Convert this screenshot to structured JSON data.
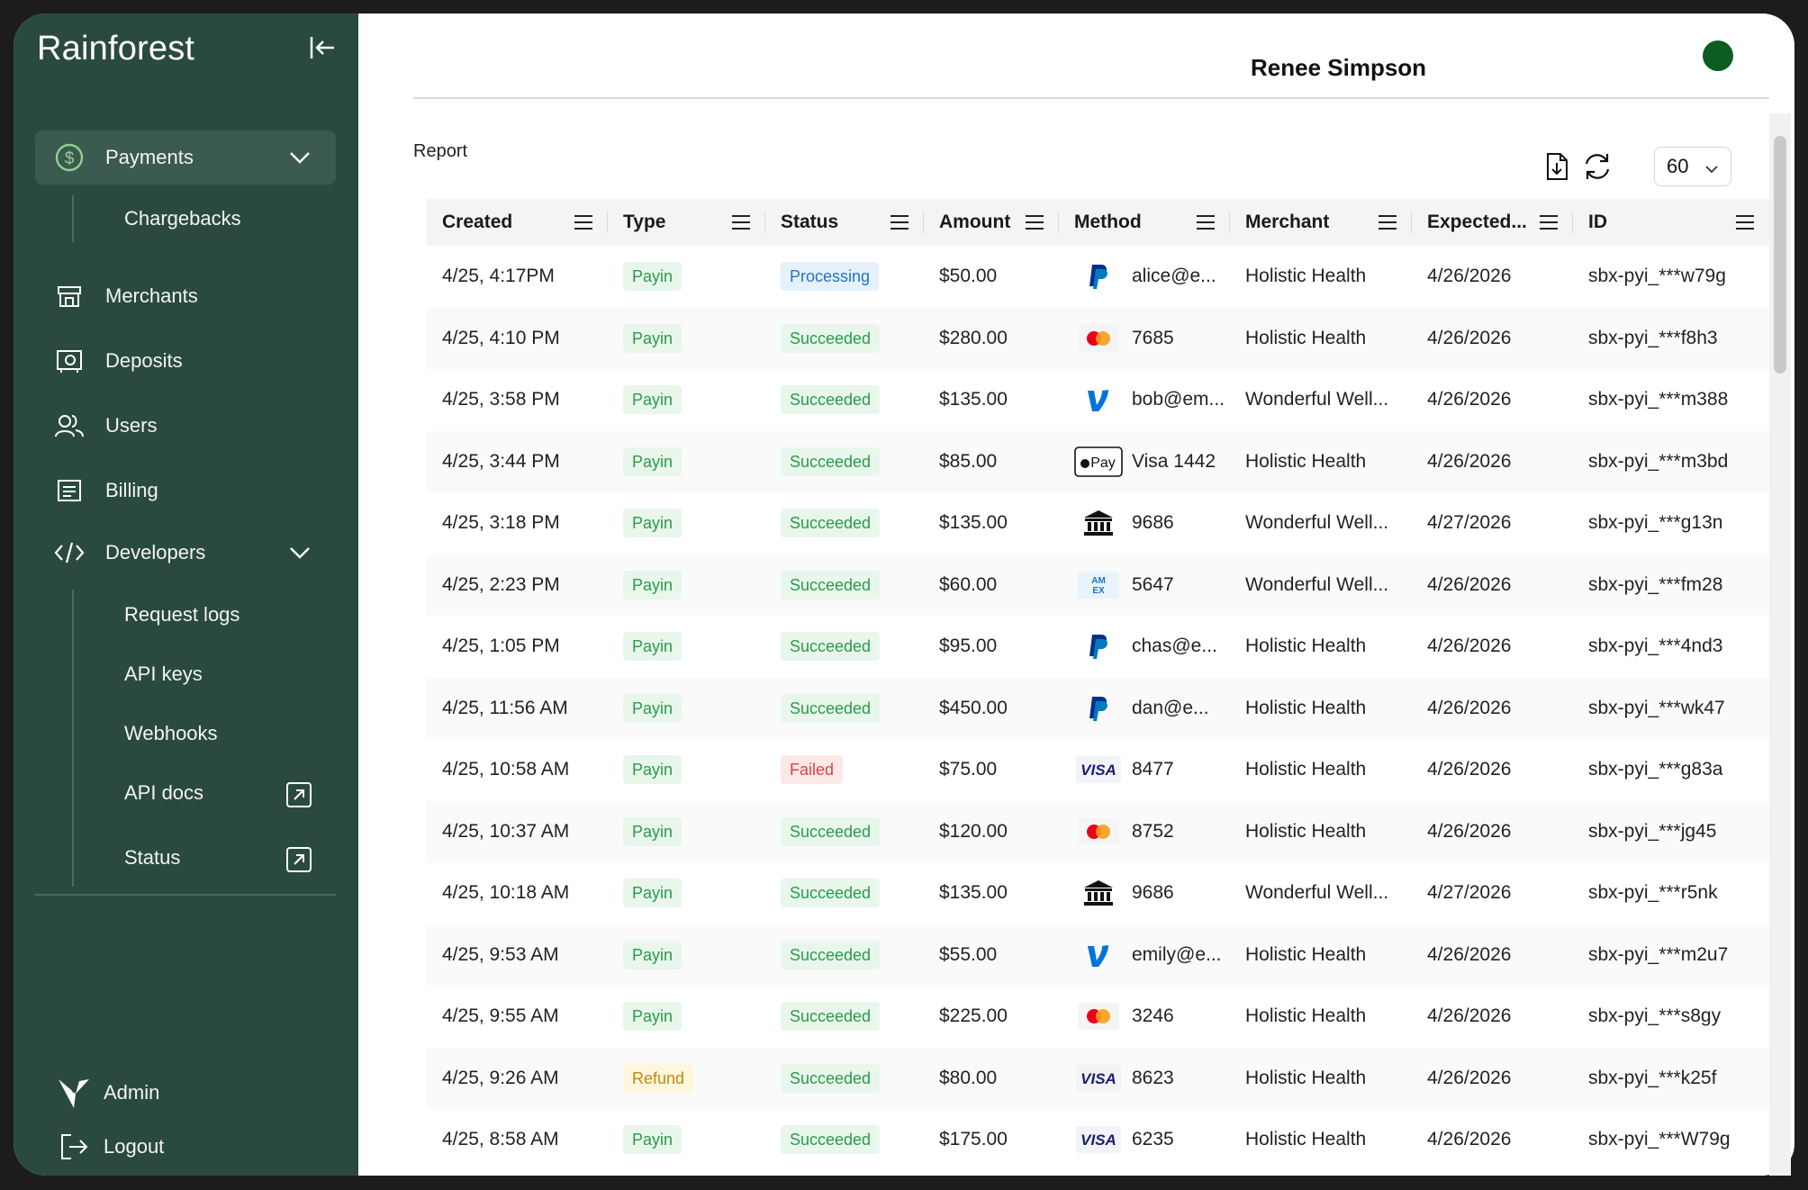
{
  "sidebar": {
    "brand": "Rainforest",
    "nav": {
      "payments": "Payments",
      "chargebacks": "Chargebacks",
      "merchants": "Merchants",
      "deposits": "Deposits",
      "users": "Users",
      "billing": "Billing",
      "developers": "Developers",
      "request_logs": "Request logs",
      "api_keys": "API keys",
      "webhooks": "Webhooks",
      "api_docs": "API docs",
      "status": "Status"
    },
    "footer": {
      "admin": "Admin",
      "logout": "Logout"
    }
  },
  "header": {
    "user_name": "Renee Simpson",
    "avatar_color": "#0d5c24"
  },
  "report": {
    "title": "Report",
    "page_size": "60"
  },
  "columns": [
    "Created",
    "Type",
    "Status",
    "Amount",
    "Method",
    "Merchant",
    "Expected...",
    "ID"
  ],
  "rows": [
    {
      "created": "4/25, 4:17PM",
      "type": "Payin",
      "status": "Processing",
      "amount": "$50.00",
      "method_icon": "paypal-icon",
      "method": "alice@e...",
      "merchant": "Holistic Health",
      "expected": "4/26/2026",
      "id": "sbx-pyi_***w79g"
    },
    {
      "created": "4/25, 4:10 PM",
      "type": "Payin",
      "status": "Succeeded",
      "amount": "$280.00",
      "method_icon": "mastercard-icon",
      "method": "7685",
      "merchant": "Holistic Health",
      "expected": "4/26/2026",
      "id": "sbx-pyi_***f8h3"
    },
    {
      "created": "4/25, 3:58 PM",
      "type": "Payin",
      "status": "Succeeded",
      "amount": "$135.00",
      "method_icon": "venmo-icon",
      "method": "bob@em...",
      "merchant": "Wonderful Well...",
      "expected": "4/26/2026",
      "id": "sbx-pyi_***m388"
    },
    {
      "created": "4/25, 3:44 PM",
      "type": "Payin",
      "status": "Succeeded",
      "amount": "$85.00",
      "method_icon": "apple-pay-icon",
      "method": "Visa 1442",
      "merchant": "Holistic Health",
      "expected": "4/26/2026",
      "id": "sbx-pyi_***m3bd"
    },
    {
      "created": "4/25, 3:18 PM",
      "type": "Payin",
      "status": "Succeeded",
      "amount": "$135.00",
      "method_icon": "bank-icon",
      "method": "9686",
      "merchant": "Wonderful Well...",
      "expected": "4/27/2026",
      "id": "sbx-pyi_***g13n"
    },
    {
      "created": "4/25, 2:23 PM",
      "type": "Payin",
      "status": "Succeeded",
      "amount": "$60.00",
      "method_icon": "amex-icon",
      "method": "5647",
      "merchant": "Wonderful Well...",
      "expected": "4/26/2026",
      "id": "sbx-pyi_***fm28"
    },
    {
      "created": "4/25, 1:05 PM",
      "type": "Payin",
      "status": "Succeeded",
      "amount": "$95.00",
      "method_icon": "paypal-icon",
      "method": "chas@e...",
      "merchant": "Holistic Health",
      "expected": "4/26/2026",
      "id": "sbx-pyi_***4nd3"
    },
    {
      "created": "4/25, 11:56 AM",
      "type": "Payin",
      "status": "Succeeded",
      "amount": "$450.00",
      "method_icon": "paypal-icon",
      "method": "dan@e...",
      "merchant": "Holistic Health",
      "expected": "4/26/2026",
      "id": "sbx-pyi_***wk47"
    },
    {
      "created": "4/25, 10:58 AM",
      "type": "Payin",
      "status": "Failed",
      "amount": "$75.00",
      "method_icon": "visa-icon",
      "method": "8477",
      "merchant": "Holistic Health",
      "expected": "4/26/2026",
      "id": "sbx-pyi_***g83a"
    },
    {
      "created": "4/25, 10:37 AM",
      "type": "Payin",
      "status": "Succeeded",
      "amount": "$120.00",
      "method_icon": "mastercard-icon",
      "method": "8752",
      "merchant": "Holistic Health",
      "expected": "4/26/2026",
      "id": "sbx-pyi_***jg45"
    },
    {
      "created": "4/25, 10:18 AM",
      "type": "Payin",
      "status": "Succeeded",
      "amount": "$135.00",
      "method_icon": "bank-icon",
      "method": "9686",
      "merchant": "Wonderful Well...",
      "expected": "4/27/2026",
      "id": "sbx-pyi_***r5nk"
    },
    {
      "created": "4/25, 9:53 AM",
      "type": "Payin",
      "status": "Succeeded",
      "amount": "$55.00",
      "method_icon": "venmo-icon",
      "method": "emily@e...",
      "merchant": "Holistic Health",
      "expected": "4/26/2026",
      "id": "sbx-pyi_***m2u7"
    },
    {
      "created": "4/25, 9:55 AM",
      "type": "Payin",
      "status": "Succeeded",
      "amount": "$225.00",
      "method_icon": "mastercard-icon",
      "method": "3246",
      "merchant": "Holistic Health",
      "expected": "4/26/2026",
      "id": "sbx-pyi_***s8gy"
    },
    {
      "created": "4/25, 9:26 AM",
      "type": "Refund",
      "status": "Succeeded",
      "amount": "$80.00",
      "method_icon": "visa-icon",
      "method": "8623",
      "merchant": "Holistic Health",
      "expected": "4/26/2026",
      "id": "sbx-pyi_***k25f"
    },
    {
      "created": "4/25, 8:58 AM",
      "type": "Payin",
      "status": "Succeeded",
      "amount": "$175.00",
      "method_icon": "visa-icon",
      "method": "6235",
      "merchant": "Holistic Health",
      "expected": "4/26/2026",
      "id": "sbx-pyi_***W79g"
    }
  ],
  "icon_glyphs": {
    "apple_pay": "Pay",
    "amex": "AM EX",
    "visa": "VISA"
  },
  "colors": {
    "sidebar_bg": "#2b4a3f",
    "payin": "#2a9b4a",
    "processing": "#1f74c9",
    "failed": "#d64545",
    "refund": "#c08a10"
  }
}
